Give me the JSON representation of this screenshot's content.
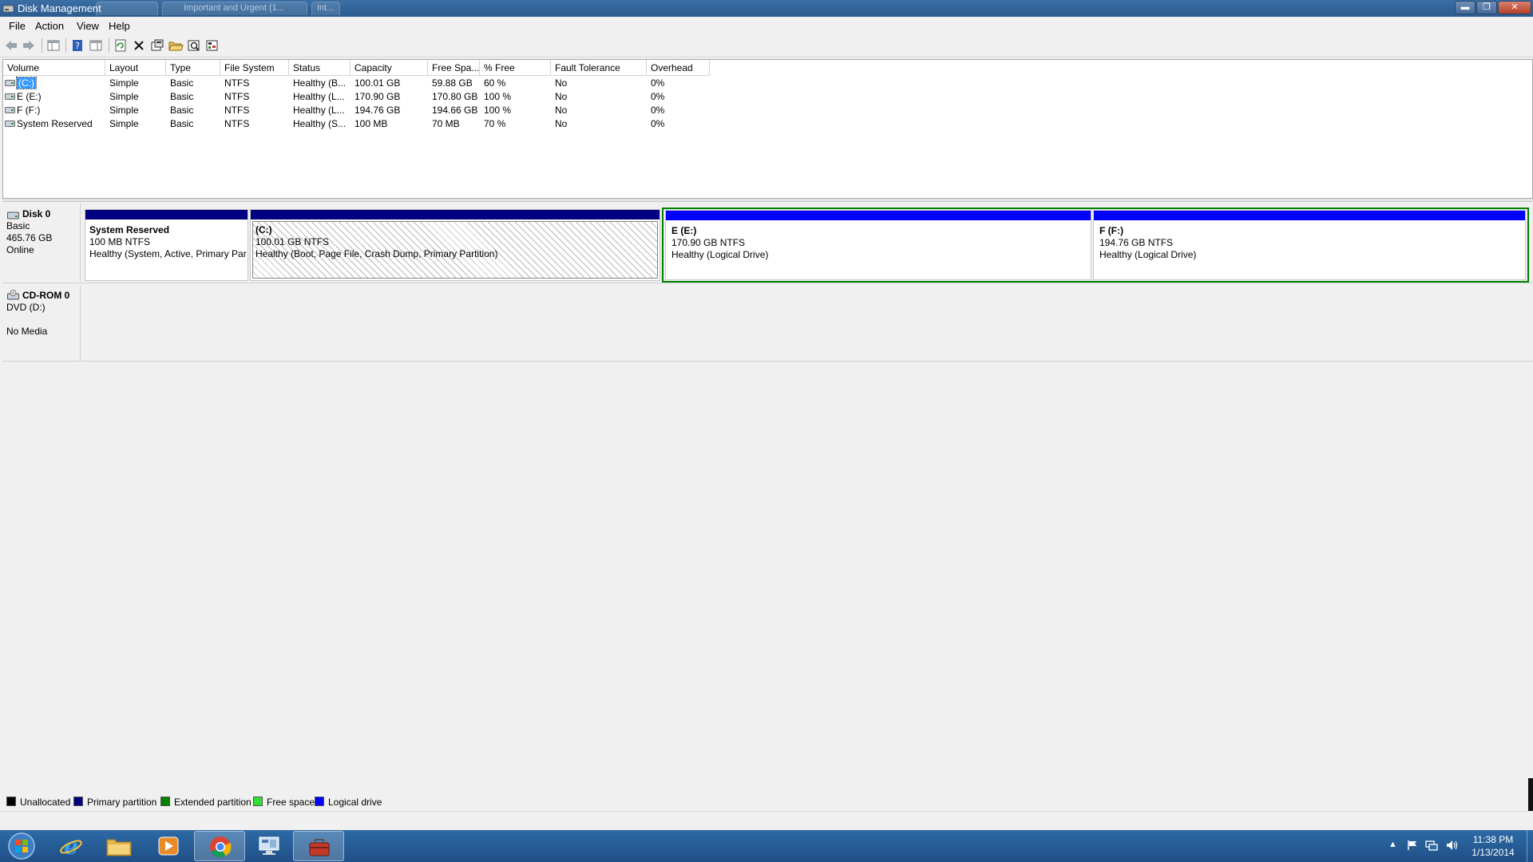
{
  "window": {
    "title": "Disk Management",
    "bg_tabs": [
      "",
      "Important and Urgent (1...",
      "Int..."
    ]
  },
  "menu": [
    "File",
    "Action",
    "View",
    "Help"
  ],
  "toolbar": [
    "back-icon",
    "forward-icon",
    "console-tree-icon",
    "help-icon",
    "show-hide-icon",
    "refresh-icon",
    "delete-icon",
    "properties-icon",
    "open-icon",
    "explore-icon",
    "settings-icon"
  ],
  "volumes": {
    "columns": [
      "Volume",
      "Layout",
      "Type",
      "File System",
      "Status",
      "Capacity",
      "Free Spa...",
      "% Free",
      "Fault Tolerance",
      "Overhead"
    ],
    "rows": [
      {
        "volume": "(C:)",
        "layout": "Simple",
        "type": "Basic",
        "fs": "NTFS",
        "status": "Healthy (B...",
        "capacity": "100.01 GB",
        "free": "59.88 GB",
        "pct": "60 %",
        "fault": "No",
        "overhead": "0%"
      },
      {
        "volume": "E (E:)",
        "layout": "Simple",
        "type": "Basic",
        "fs": "NTFS",
        "status": "Healthy (L...",
        "capacity": "170.90 GB",
        "free": "170.80 GB",
        "pct": "100 %",
        "fault": "No",
        "overhead": "0%"
      },
      {
        "volume": "F (F:)",
        "layout": "Simple",
        "type": "Basic",
        "fs": "NTFS",
        "status": "Healthy (L...",
        "capacity": "194.76 GB",
        "free": "194.66 GB",
        "pct": "100 %",
        "fault": "No",
        "overhead": "0%"
      },
      {
        "volume": "System Reserved",
        "layout": "Simple",
        "type": "Basic",
        "fs": "NTFS",
        "status": "Healthy (S...",
        "capacity": "100 MB",
        "free": "70 MB",
        "pct": "70 %",
        "fault": "No",
        "overhead": "0%"
      }
    ]
  },
  "disk0": {
    "name": "Disk 0",
    "type": "Basic",
    "size": "465.76 GB",
    "state": "Online",
    "partitions": [
      {
        "name": "System Reserved",
        "size": "100 MB NTFS",
        "status": "Healthy (System, Active, Primary Par"
      },
      {
        "name": "(C:)",
        "size": "100.01 GB NTFS",
        "status": "Healthy (Boot, Page File, Crash Dump, Primary Partition)"
      },
      {
        "name": "E  (E:)",
        "size": "170.90 GB NTFS",
        "status": "Healthy (Logical Drive)"
      },
      {
        "name": "F  (F:)",
        "size": "194.76 GB NTFS",
        "status": "Healthy (Logical Drive)"
      }
    ]
  },
  "cdrom0": {
    "name": "CD-ROM 0",
    "drive": "DVD (D:)",
    "media": "No Media"
  },
  "legend": [
    {
      "label": "Unallocated",
      "color": "#000000"
    },
    {
      "label": "Primary partition",
      "color": "#000080"
    },
    {
      "label": "Extended partition",
      "color": "#008000"
    },
    {
      "label": "Free space",
      "color": "#33dd33"
    },
    {
      "label": "Logical drive",
      "color": "#0000ff"
    }
  ],
  "colors": {
    "primary_bar": "#000080",
    "logical_bar": "#0000ff",
    "extended_border": "#008000"
  },
  "taskbar": {
    "apps": [
      "start-orb-icon",
      "internet-explorer-icon",
      "file-explorer-icon",
      "media-player-icon",
      "chrome-icon",
      "computer-management-icon",
      "toolbox-icon"
    ]
  },
  "clock": {
    "time": "11:38 PM",
    "date": "1/13/2014"
  }
}
